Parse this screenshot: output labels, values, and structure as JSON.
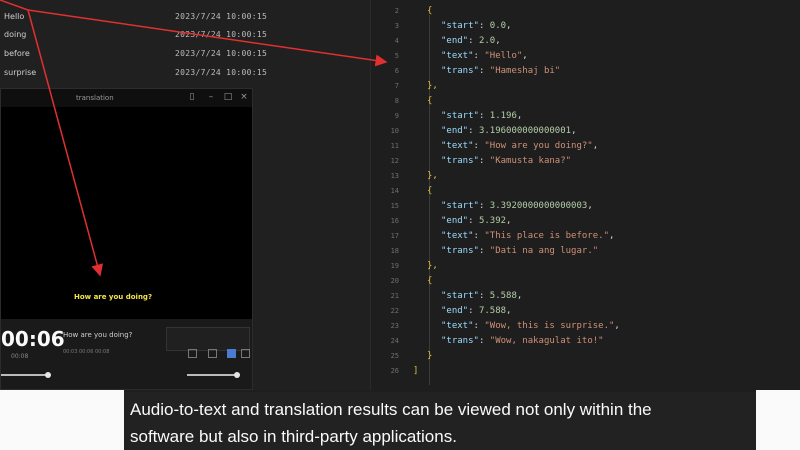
{
  "file_list": {
    "rows": [
      {
        "name": "Hello",
        "date": "2023/7/24 10:00:15"
      },
      {
        "name": "doing",
        "date": "2023/7/24 10:00:15"
      },
      {
        "name": "before",
        "date": "2023/7/24 10:00:15"
      },
      {
        "name": "surprise",
        "date": "2023/7/24 10:00:15"
      }
    ]
  },
  "player": {
    "title": "translation",
    "subtitle_overlay": "How are you doing?",
    "timecode": "00:06",
    "timecode_sub": "00:08",
    "current_subtitle": "How are you doing?",
    "sub_meta": "00:03  00:06  00:08"
  },
  "editor": {
    "lines": [
      {
        "n": "2",
        "indent": 1,
        "parts": [
          [
            "{",
            "brace"
          ]
        ]
      },
      {
        "n": "3",
        "indent": 2,
        "parts": [
          [
            "\"start\"",
            "key"
          ],
          [
            ": ",
            "punc"
          ],
          [
            "0.0",
            "num"
          ],
          [
            ",",
            "punc"
          ]
        ]
      },
      {
        "n": "4",
        "indent": 2,
        "parts": [
          [
            "\"end\"",
            "key"
          ],
          [
            ": ",
            "punc"
          ],
          [
            "2.0",
            "num"
          ],
          [
            ",",
            "punc"
          ]
        ]
      },
      {
        "n": "5",
        "indent": 2,
        "parts": [
          [
            "\"text\"",
            "key"
          ],
          [
            ": ",
            "punc"
          ],
          [
            "\"Hello\"",
            "str"
          ],
          [
            ",",
            "punc"
          ]
        ]
      },
      {
        "n": "6",
        "indent": 2,
        "parts": [
          [
            "\"trans\"",
            "key"
          ],
          [
            ": ",
            "punc"
          ],
          [
            "\"Hameshaj bi\"",
            "str"
          ]
        ]
      },
      {
        "n": "7",
        "indent": 1,
        "parts": [
          [
            "},",
            "brace"
          ]
        ]
      },
      {
        "n": "8",
        "indent": 1,
        "parts": [
          [
            "{",
            "brace"
          ]
        ]
      },
      {
        "n": "9",
        "indent": 2,
        "parts": [
          [
            "\"start\"",
            "key"
          ],
          [
            ": ",
            "punc"
          ],
          [
            "1.196",
            "num"
          ],
          [
            ",",
            "punc"
          ]
        ]
      },
      {
        "n": "10",
        "indent": 2,
        "parts": [
          [
            "\"end\"",
            "key"
          ],
          [
            ": ",
            "punc"
          ],
          [
            "3.196000000000001",
            "num"
          ],
          [
            ",",
            "punc"
          ]
        ]
      },
      {
        "n": "11",
        "indent": 2,
        "parts": [
          [
            "\"text\"",
            "key"
          ],
          [
            ": ",
            "punc"
          ],
          [
            "\"How are you doing?\"",
            "str"
          ],
          [
            ",",
            "punc"
          ]
        ]
      },
      {
        "n": "12",
        "indent": 2,
        "parts": [
          [
            "\"trans\"",
            "key"
          ],
          [
            ": ",
            "punc"
          ],
          [
            "\"Kamusta kana?\"",
            "str"
          ]
        ]
      },
      {
        "n": "13",
        "indent": 1,
        "parts": [
          [
            "},",
            "brace"
          ]
        ]
      },
      {
        "n": "14",
        "indent": 1,
        "parts": [
          [
            "{",
            "brace"
          ]
        ]
      },
      {
        "n": "15",
        "indent": 2,
        "parts": [
          [
            "\"start\"",
            "key"
          ],
          [
            ": ",
            "punc"
          ],
          [
            "3.3920000000000003",
            "num"
          ],
          [
            ",",
            "punc"
          ]
        ]
      },
      {
        "n": "16",
        "indent": 2,
        "parts": [
          [
            "\"end\"",
            "key"
          ],
          [
            ": ",
            "punc"
          ],
          [
            "5.392",
            "num"
          ],
          [
            ",",
            "punc"
          ]
        ]
      },
      {
        "n": "17",
        "indent": 2,
        "parts": [
          [
            "\"text\"",
            "key"
          ],
          [
            ": ",
            "punc"
          ],
          [
            "\"This place is before.\"",
            "str"
          ],
          [
            ",",
            "punc"
          ]
        ]
      },
      {
        "n": "18",
        "indent": 2,
        "parts": [
          [
            "\"trans\"",
            "key"
          ],
          [
            ": ",
            "punc"
          ],
          [
            "\"Dati na ang lugar.\"",
            "str"
          ]
        ]
      },
      {
        "n": "19",
        "indent": 1,
        "parts": [
          [
            "},",
            "brace"
          ]
        ]
      },
      {
        "n": "20",
        "indent": 1,
        "parts": [
          [
            "{",
            "brace"
          ]
        ]
      },
      {
        "n": "21",
        "indent": 2,
        "parts": [
          [
            "\"start\"",
            "key"
          ],
          [
            ": ",
            "punc"
          ],
          [
            "5.588",
            "num"
          ],
          [
            ",",
            "punc"
          ]
        ]
      },
      {
        "n": "22",
        "indent": 2,
        "parts": [
          [
            "\"end\"",
            "key"
          ],
          [
            ": ",
            "punc"
          ],
          [
            "7.588",
            "num"
          ],
          [
            ",",
            "punc"
          ]
        ]
      },
      {
        "n": "23",
        "indent": 2,
        "parts": [
          [
            "\"text\"",
            "key"
          ],
          [
            ": ",
            "punc"
          ],
          [
            "\"Wow, this is surprise.\"",
            "str"
          ],
          [
            ",",
            "punc"
          ]
        ]
      },
      {
        "n": "24",
        "indent": 2,
        "parts": [
          [
            "\"trans\"",
            "key"
          ],
          [
            ": ",
            "punc"
          ],
          [
            "\"Wow, nakagulat ito!\"",
            "str"
          ]
        ]
      },
      {
        "n": "25",
        "indent": 1,
        "parts": [
          [
            "}",
            "brace"
          ]
        ]
      },
      {
        "n": "26",
        "indent": 0,
        "parts": [
          [
            "]",
            "brace"
          ]
        ]
      }
    ]
  },
  "caption": {
    "line1": "Audio-to-text and translation results can be viewed not only within the",
    "line2": "software but also in third-party applications."
  }
}
